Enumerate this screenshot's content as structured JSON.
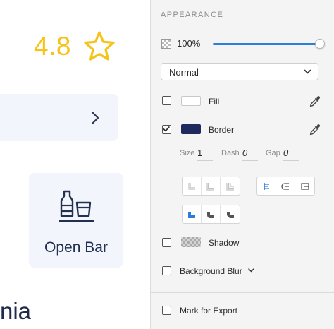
{
  "canvas": {
    "rating": {
      "value": "4.8",
      "star_icon": "star-outline-icon",
      "color": "#f6c319"
    },
    "nav_card": {
      "icon": "chevron-right-icon"
    },
    "bar_card": {
      "label": "Open Bar",
      "icon": "bottle-glass-icon"
    },
    "partial_text": "nia"
  },
  "panel": {
    "section_title": "APPEARANCE",
    "opacity": {
      "icon": "opacity-checker-icon",
      "value": "100%",
      "slider_level": 1.0,
      "accent": "#2d7ed8"
    },
    "blend_mode": {
      "value": "Normal",
      "icon": "chevron-down-icon"
    },
    "fill": {
      "label": "Fill",
      "checked": false,
      "color": "#ffffff",
      "icon": "eyedropper-icon"
    },
    "border": {
      "label": "Border",
      "checked": true,
      "color": "#1e2a5e",
      "icon": "eyedropper-icon",
      "size_label": "Size",
      "size_value": "1",
      "dash_label": "Dash",
      "dash_value": "0",
      "gap_label": "Gap",
      "gap_value": "0",
      "position_buttons": [
        "border-inside-icon",
        "border-center-icon",
        "border-outside-icon"
      ],
      "align_buttons": [
        "align-left-icon",
        "align-center-icon",
        "align-right-icon"
      ],
      "corner_buttons": [
        "corner-square-icon",
        "corner-round-icon",
        "corner-bevel-icon"
      ]
    },
    "shadow": {
      "label": "Shadow",
      "checked": false
    },
    "background_blur": {
      "label": "Background Blur",
      "checked": false,
      "icon": "chevron-down-icon"
    },
    "export": {
      "label": "Mark for Export",
      "checked": false
    }
  }
}
